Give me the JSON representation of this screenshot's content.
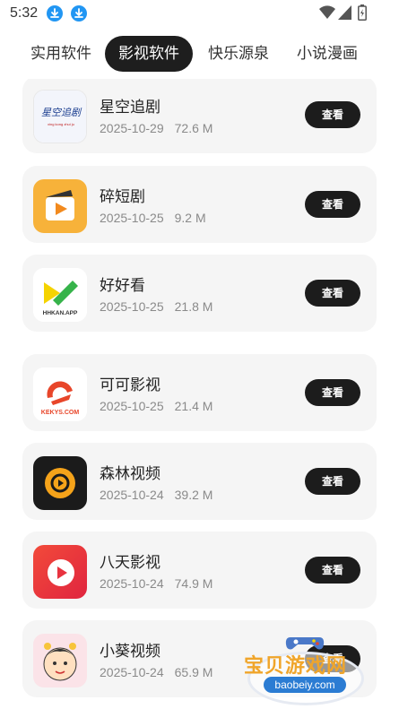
{
  "status_bar": {
    "time": "5:32",
    "icons": [
      "download-icon",
      "download-icon",
      "wifi-icon",
      "signal-icon",
      "battery-icon"
    ]
  },
  "tabs": [
    {
      "label": "实用软件",
      "active": false
    },
    {
      "label": "影视软件",
      "active": true
    },
    {
      "label": "快乐源泉",
      "active": false
    },
    {
      "label": "小说漫画",
      "active": false
    }
  ],
  "apps": [
    {
      "name": "星空追剧",
      "date": "2025-10-29",
      "size": "72.6 M",
      "button": "查看",
      "icon": "xingkong-logo",
      "icon_text": "星空追剧",
      "icon_subtext": "xing kong zhui ju"
    },
    {
      "name": "碎短剧",
      "date": "2025-10-25",
      "size": "9.2 M",
      "button": "查看",
      "icon": "clapperboard-play-logo"
    },
    {
      "name": "好好看",
      "date": "2025-10-25",
      "size": "21.8 M",
      "button": "查看",
      "icon": "hhkan-logo",
      "icon_text": "HHKAN.APP"
    },
    {
      "name": "可可影视",
      "date": "2025-10-25",
      "size": "21.4 M",
      "button": "查看",
      "icon": "kekys-logo",
      "icon_text": "KEKYS.COM"
    },
    {
      "name": "森林视频",
      "date": "2025-10-24",
      "size": "39.2 M",
      "button": "查看",
      "icon": "senlin-logo"
    },
    {
      "name": "八天影视",
      "date": "2025-10-24",
      "size": "74.9 M",
      "button": "查看",
      "icon": "play-logo"
    },
    {
      "name": "小葵视频",
      "date": "2025-10-24",
      "size": "65.9 M",
      "button": "查看",
      "icon": "cartoon-kid-logo"
    }
  ],
  "watermark": {
    "title": "宝贝游戏网",
    "url": "baobeiy.com"
  },
  "colors": {
    "active_tab": "#1e1e1e",
    "card_bg": "#f5f5f5",
    "button_bg": "#1c1c1c",
    "meta_text": "#8a8a8a",
    "download_badge": "#2196f3"
  }
}
